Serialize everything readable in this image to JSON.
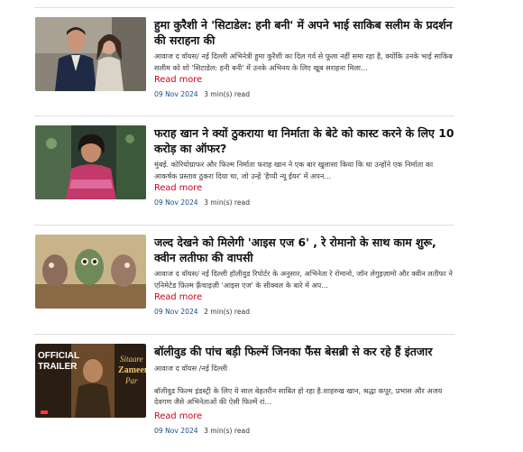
{
  "articles": [
    {
      "title": "हुमा कुरैशी ने 'सिटाडेल: हनी बनी' में अपने भाई साकिब सलीम के प्रदर्शन की सराहना की",
      "excerpt": "आवाज द वॉयस/ नई दिल्ली    अभिनेत्री हुमा कुरैशी का दिल गर्व से फूला नहीं समा रहा है, क्योंकि उनके भाई साकिब सलीम को शो 'सिटाडेल: हनी बनी' में उनके अभिनय के लिए खूब सराहना मिला...",
      "read_more": "Read more",
      "date": "09 Nov 2024",
      "read_time": "3 min(s) read"
    },
    {
      "title": "फराह खान ने क्यों ठुकराया था निर्माता के बेटे को कास्ट करने के लिए 10 करोड़ का ऑफर?",
      "excerpt": "मुंबई. कोरियोग्राफर और फिल्म निर्माता फराह खान ने एक बार खुलासा किया कि था उन्होंने एक निर्माता का आकर्षक प्रस्ताव ठुकरा दिया था, जो उन्हें 'हैप्पी न्यू ईयर' में अपन...",
      "read_more": "Read more",
      "date": "09 Nov 2024",
      "read_time": "3 min(s) read"
    },
    {
      "title": "जल्द देखने को मिलेगी 'आइस एज 6' , रे रोमानो के साथ काम शुरू, क्वीन लतीफा की वापसी",
      "excerpt": "आवाज द वॉयस/ नई दिल्ली    हॉलीवुड रिपोर्टर के अनुसार, अभिनेता रे रोमानो, जॉन लेगुइज़ामो और क्वीन लतीफा ने एनिमेटेड फ़िल्म फ़्रैंचाइज़ी 'आइस एज' के सीक्वल के बारे में अप...",
      "read_more": "Read more",
      "date": "09 Nov 2024",
      "read_time": "2 min(s) read"
    },
    {
      "title": "बॉलीवुड की पांच बड़ी फिल्में जिनका फैंस बेसब्री से कर रहे हैं इंतजार",
      "excerpt_lines": [
        "आवाज द वॉयस /नई दिल्ली",
        "",
        "बॉलीवुड फिल्म इंडस्ट्री के लिए ये साल बेहतरीन साबित हो रहा है.शाहरुख खान, श्रद्धा कपूर, प्रभास और अजय देवगण जैसे अभिनेताओं की ऐसी फिल्में रां..."
      ],
      "read_more": "Read more",
      "date": "09 Nov 2024",
      "read_time": "3 min(s) read",
      "thumb_text": {
        "badge_line1": "OFFICIAL",
        "badge_line2": "TRAILER",
        "logo_line1": "Sitaare",
        "logo_line2": "Zameen",
        "logo_line3": "Par"
      }
    }
  ],
  "colors": {
    "title": "#111111",
    "read_more": "#d0021b",
    "date": "#1a4e8a",
    "divider": "#dddddd"
  },
  "icons": [
    "article-thumbnail"
  ]
}
